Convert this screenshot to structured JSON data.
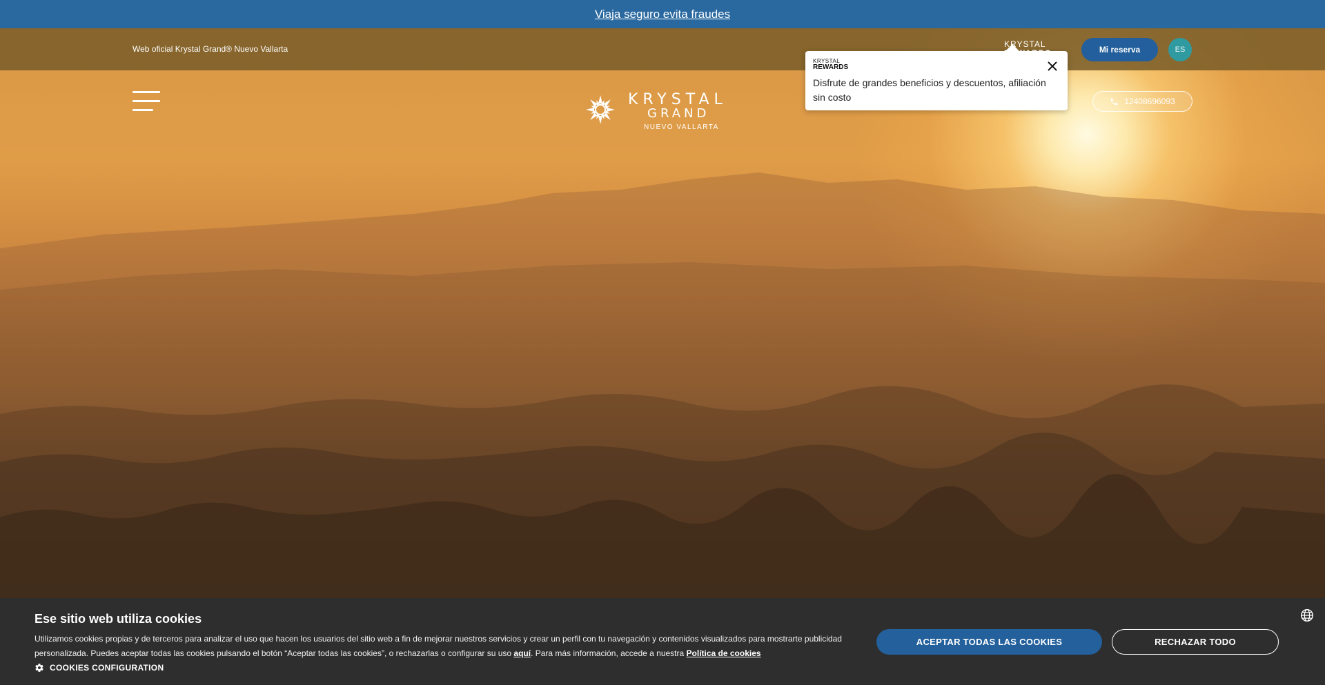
{
  "top_banner": {
    "link_text": "Viaja seguro evita fraudes"
  },
  "header": {
    "official_text": "Web oficial Krystal Grand® Nuevo Vallarta",
    "rewards_logo": {
      "line1": "KRYSTAL",
      "line2": "REWARDS"
    },
    "my_booking_label": "Mi reserva",
    "language": "ES"
  },
  "logo": {
    "line1": "KRYSTAL",
    "line2": "GRAND",
    "line3": "NUEVO VALLARTA"
  },
  "phone": {
    "icon": "phone-icon",
    "number": "12408696093"
  },
  "rewards_popup": {
    "logo_line1": "KRYSTAL",
    "logo_line2": "REWARDS",
    "message": "Disfrute de grandes beneficios y descuentos, afiliación sin costo"
  },
  "cookies": {
    "title": "Ese sitio web utiliza cookies",
    "text_part1": "Utilizamos cookies propias y de terceros para analizar el uso que hacen los usuarios del sitio web a fin de mejorar nuestros servicios y crear un perfil con tu navegación y contenidos visualizados para mostrarte publicidad personalizada. Puedes aceptar todas las cookies pulsando el botón “Aceptar todas las cookies”, o rechazarlas o configurar su uso ",
    "link_here": "aquí",
    "text_part2": ". Para más información, accede a nuestra ",
    "link_policy": "Política de cookies",
    "config_label": "COOKIES CONFIGURATION",
    "accept_label": "ACEPTAR TODAS LAS COOKIES",
    "reject_label": "RECHAZAR TODO"
  },
  "colors": {
    "banner_blue": "#2a69a0",
    "button_blue": "#225f9c",
    "lang_teal": "#2f9aa0",
    "cookie_bg": "#2e2e2e"
  }
}
